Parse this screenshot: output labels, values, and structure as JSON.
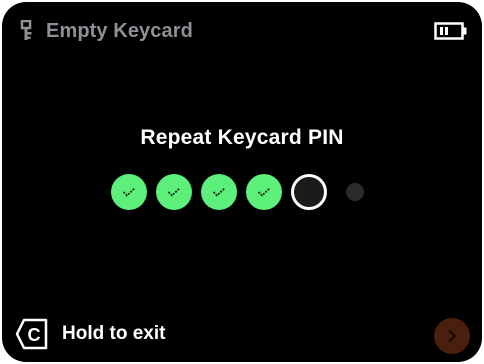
{
  "header": {
    "icon": "keycard-key-icon",
    "title": "Empty Keycard",
    "battery_icon": "battery-icon"
  },
  "main": {
    "prompt": "Repeat Keycard PIN",
    "pin": {
      "length": 6,
      "entered": 4,
      "filled_icon": "check-icon",
      "colors": {
        "filled": "#5cf07a",
        "current_ring": "#ffffff",
        "empty": "#2b2b2e"
      }
    }
  },
  "footer": {
    "exit_key_icon": "c-key-icon",
    "exit_label": "Hold to exit",
    "next_icon": "chevron-right-icon",
    "next_color": "#4a1f0d"
  }
}
